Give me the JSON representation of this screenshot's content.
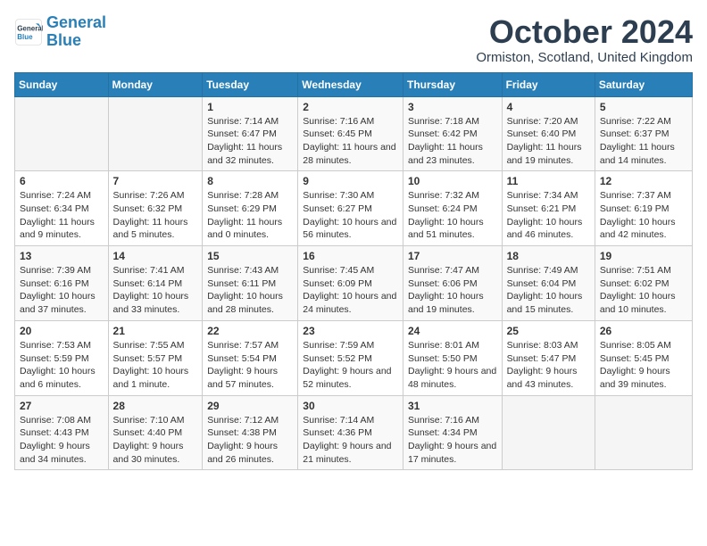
{
  "header": {
    "logo_line1": "General",
    "logo_line2": "Blue",
    "title": "October 2024",
    "location": "Ormiston, Scotland, United Kingdom"
  },
  "columns": [
    "Sunday",
    "Monday",
    "Tuesday",
    "Wednesday",
    "Thursday",
    "Friday",
    "Saturday"
  ],
  "weeks": [
    [
      {
        "day": "",
        "info": ""
      },
      {
        "day": "",
        "info": ""
      },
      {
        "day": "1",
        "info": "Sunrise: 7:14 AM\nSunset: 6:47 PM\nDaylight: 11 hours and 32 minutes."
      },
      {
        "day": "2",
        "info": "Sunrise: 7:16 AM\nSunset: 6:45 PM\nDaylight: 11 hours and 28 minutes."
      },
      {
        "day": "3",
        "info": "Sunrise: 7:18 AM\nSunset: 6:42 PM\nDaylight: 11 hours and 23 minutes."
      },
      {
        "day": "4",
        "info": "Sunrise: 7:20 AM\nSunset: 6:40 PM\nDaylight: 11 hours and 19 minutes."
      },
      {
        "day": "5",
        "info": "Sunrise: 7:22 AM\nSunset: 6:37 PM\nDaylight: 11 hours and 14 minutes."
      }
    ],
    [
      {
        "day": "6",
        "info": "Sunrise: 7:24 AM\nSunset: 6:34 PM\nDaylight: 11 hours and 9 minutes."
      },
      {
        "day": "7",
        "info": "Sunrise: 7:26 AM\nSunset: 6:32 PM\nDaylight: 11 hours and 5 minutes."
      },
      {
        "day": "8",
        "info": "Sunrise: 7:28 AM\nSunset: 6:29 PM\nDaylight: 11 hours and 0 minutes."
      },
      {
        "day": "9",
        "info": "Sunrise: 7:30 AM\nSunset: 6:27 PM\nDaylight: 10 hours and 56 minutes."
      },
      {
        "day": "10",
        "info": "Sunrise: 7:32 AM\nSunset: 6:24 PM\nDaylight: 10 hours and 51 minutes."
      },
      {
        "day": "11",
        "info": "Sunrise: 7:34 AM\nSunset: 6:21 PM\nDaylight: 10 hours and 46 minutes."
      },
      {
        "day": "12",
        "info": "Sunrise: 7:37 AM\nSunset: 6:19 PM\nDaylight: 10 hours and 42 minutes."
      }
    ],
    [
      {
        "day": "13",
        "info": "Sunrise: 7:39 AM\nSunset: 6:16 PM\nDaylight: 10 hours and 37 minutes."
      },
      {
        "day": "14",
        "info": "Sunrise: 7:41 AM\nSunset: 6:14 PM\nDaylight: 10 hours and 33 minutes."
      },
      {
        "day": "15",
        "info": "Sunrise: 7:43 AM\nSunset: 6:11 PM\nDaylight: 10 hours and 28 minutes."
      },
      {
        "day": "16",
        "info": "Sunrise: 7:45 AM\nSunset: 6:09 PM\nDaylight: 10 hours and 24 minutes."
      },
      {
        "day": "17",
        "info": "Sunrise: 7:47 AM\nSunset: 6:06 PM\nDaylight: 10 hours and 19 minutes."
      },
      {
        "day": "18",
        "info": "Sunrise: 7:49 AM\nSunset: 6:04 PM\nDaylight: 10 hours and 15 minutes."
      },
      {
        "day": "19",
        "info": "Sunrise: 7:51 AM\nSunset: 6:02 PM\nDaylight: 10 hours and 10 minutes."
      }
    ],
    [
      {
        "day": "20",
        "info": "Sunrise: 7:53 AM\nSunset: 5:59 PM\nDaylight: 10 hours and 6 minutes."
      },
      {
        "day": "21",
        "info": "Sunrise: 7:55 AM\nSunset: 5:57 PM\nDaylight: 10 hours and 1 minute."
      },
      {
        "day": "22",
        "info": "Sunrise: 7:57 AM\nSunset: 5:54 PM\nDaylight: 9 hours and 57 minutes."
      },
      {
        "day": "23",
        "info": "Sunrise: 7:59 AM\nSunset: 5:52 PM\nDaylight: 9 hours and 52 minutes."
      },
      {
        "day": "24",
        "info": "Sunrise: 8:01 AM\nSunset: 5:50 PM\nDaylight: 9 hours and 48 minutes."
      },
      {
        "day": "25",
        "info": "Sunrise: 8:03 AM\nSunset: 5:47 PM\nDaylight: 9 hours and 43 minutes."
      },
      {
        "day": "26",
        "info": "Sunrise: 8:05 AM\nSunset: 5:45 PM\nDaylight: 9 hours and 39 minutes."
      }
    ],
    [
      {
        "day": "27",
        "info": "Sunrise: 7:08 AM\nSunset: 4:43 PM\nDaylight: 9 hours and 34 minutes."
      },
      {
        "day": "28",
        "info": "Sunrise: 7:10 AM\nSunset: 4:40 PM\nDaylight: 9 hours and 30 minutes."
      },
      {
        "day": "29",
        "info": "Sunrise: 7:12 AM\nSunset: 4:38 PM\nDaylight: 9 hours and 26 minutes."
      },
      {
        "day": "30",
        "info": "Sunrise: 7:14 AM\nSunset: 4:36 PM\nDaylight: 9 hours and 21 minutes."
      },
      {
        "day": "31",
        "info": "Sunrise: 7:16 AM\nSunset: 4:34 PM\nDaylight: 9 hours and 17 minutes."
      },
      {
        "day": "",
        "info": ""
      },
      {
        "day": "",
        "info": ""
      }
    ]
  ]
}
